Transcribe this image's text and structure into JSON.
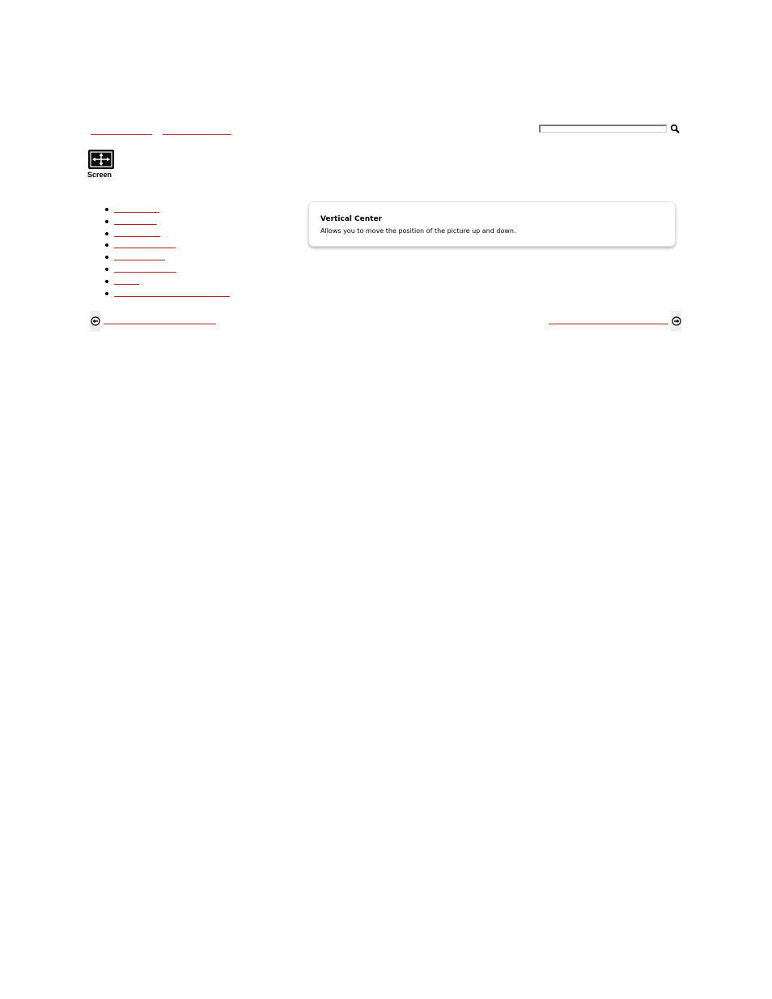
{
  "header": {
    "links": [
      {
        "name": "breadcrumb-link-1",
        "label": ""
      },
      {
        "name": "breadcrumb-link-2",
        "label": ""
      }
    ],
    "search": {
      "placeholder": "",
      "value": ""
    }
  },
  "screen_icon": {
    "label": "Screen",
    "icon": "move-arrows-icon"
  },
  "sidebar": {
    "items": [
      {
        "label": ""
      },
      {
        "label": ""
      },
      {
        "label": ""
      },
      {
        "label": ""
      },
      {
        "label": ""
      },
      {
        "label": ""
      },
      {
        "label": ""
      },
      {
        "label": ""
      }
    ]
  },
  "card": {
    "title": "Vertical Center",
    "description": "Allows you to move the position of the picture up and down."
  },
  "footer": {
    "prev_label": "",
    "next_label": ""
  },
  "colors": {
    "link": "#b22222",
    "strip": "#eeeeee"
  }
}
